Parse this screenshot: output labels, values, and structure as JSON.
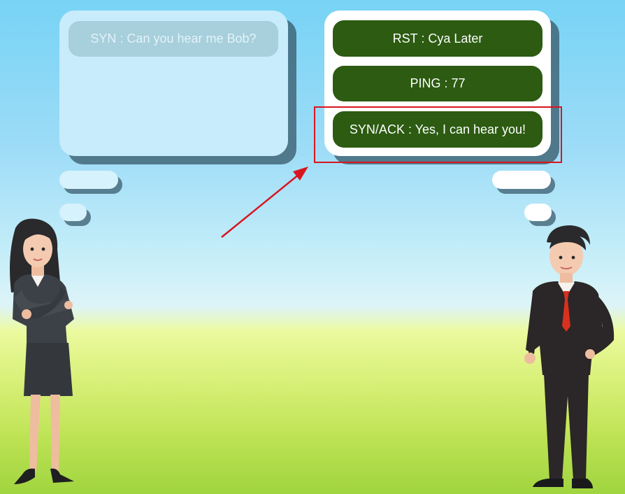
{
  "left_thought": {
    "message": "SYN : Can you hear me Bob?"
  },
  "right_thought": {
    "options": [
      {
        "label": "RST : Cya Later"
      },
      {
        "label": "PING : 77"
      },
      {
        "label": "SYN/ACK : Yes, I can hear you!"
      }
    ]
  },
  "colors": {
    "option_button": "#2c5b11",
    "highlight": "#d8151f",
    "faded_message": "#a7cfdc"
  }
}
